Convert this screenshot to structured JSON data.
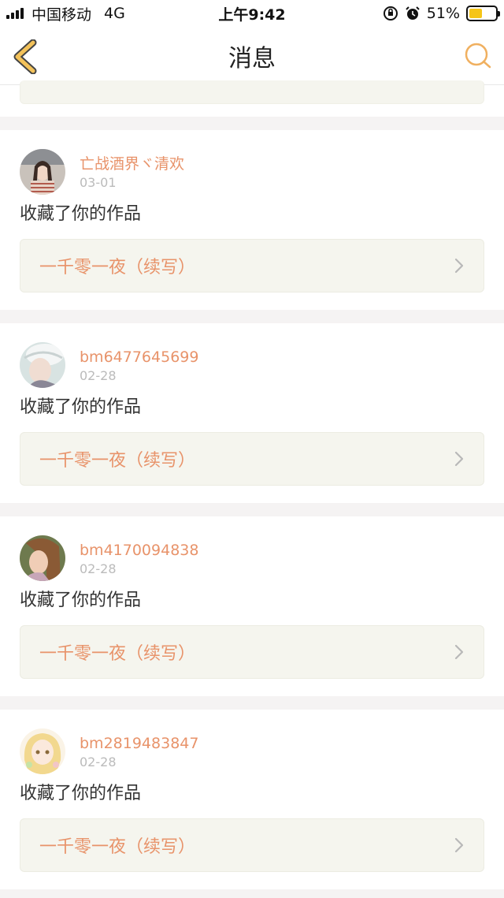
{
  "status_bar": {
    "carrier": "中国移动",
    "network": "4G",
    "time": "上午9:42",
    "battery": "51%",
    "battery_level": 0.51
  },
  "nav": {
    "title": "消息",
    "back_icon": "back-chevron-icon",
    "search_icon": "search-icon"
  },
  "colors": {
    "accent": "#e8936a",
    "nav_icon": "#f0b060",
    "card_link_bg": "#f5f5ee"
  },
  "messages": [
    {
      "username": "亡战酒界ヾ清欢",
      "date": "03-01",
      "text": "收藏了你的作品",
      "work_title": "一千零一夜（续写）",
      "avatar": "avatar-girl-braids"
    },
    {
      "username": "bm6477645699",
      "date": "02-28",
      "text": "收藏了你的作品",
      "work_title": "一千零一夜（续写）",
      "avatar": "avatar-hat"
    },
    {
      "username": "bm4170094838",
      "date": "02-28",
      "text": "收藏了你的作品",
      "work_title": "一千零一夜（续写）",
      "avatar": "avatar-brown-hair"
    },
    {
      "username": "bm2819483847",
      "date": "02-28",
      "text": "收藏了你的作品",
      "work_title": "一千零一夜（续写）",
      "avatar": "avatar-anime-blonde"
    }
  ]
}
